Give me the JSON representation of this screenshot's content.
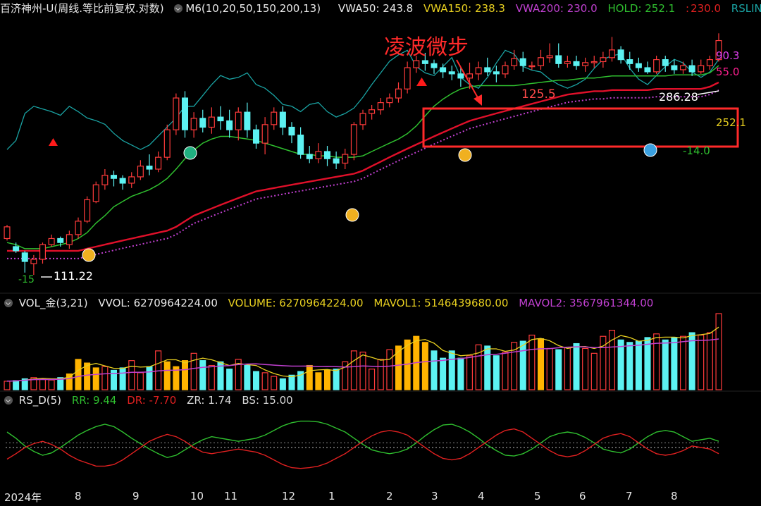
{
  "header_main": {
    "title": "百济神州-U(周线.等比前复权.对数)",
    "ma_label": "M6(10,20,50,150,200,13)",
    "vwa50": "VWA50: 243.8",
    "vwa150": "VWA150: 238.3",
    "vwa200": "VWA200: 230.0",
    "hold": "HOLD: 252.1",
    "sep": ":",
    "hold2": "230.0",
    "rslin": "RSLIN"
  },
  "header_vol": {
    "title": "VOL_金(3,21)",
    "vvol": "VVOL: 6270964224.00",
    "volume": "VOLUME: 6270964224.00",
    "mavol1": "MAVOL1: 5146439680.00",
    "mavol2": "MAVOL2: 3567961344.00"
  },
  "header_rs": {
    "title": "RS_D(5)",
    "rr": "RR: 9.44",
    "dr": "DR: -7.70",
    "zr": "ZR: 1.74",
    "bs": "BS: 15.00"
  },
  "annotations": {
    "box_title": "凌波微步",
    "peak_label": "125.5",
    "rs_high": "90.3",
    "rs_mid": "55.0",
    "price_high": "286.28",
    "price_hold": "252.1",
    "low_value": "111.22",
    "neg_14": "-14.0",
    "neg_15": "-15"
  },
  "x_labels": [
    "2024年",
    "8",
    "9",
    "10",
    "11",
    "12",
    "1",
    "2",
    "3",
    "4",
    "5",
    "6",
    "7",
    "8"
  ],
  "colors": {
    "up": "#ff3b3b",
    "down": "#5cf2f2",
    "vol_gold": "#ffb400",
    "ma_green": "#2fbf2f",
    "vwa_red": "#e0102a",
    "dotted": "#c040d0",
    "rslin": "#1aa3a3",
    "vol_ma1": "#e8d020",
    "vol_ma2": "#c040d0",
    "rs_green": "#2fbf2f",
    "rs_red": "#e02020",
    "box": "#ff2a2a"
  },
  "chart_data": [
    {
      "type": "candlestick",
      "title": "百济神州-U(周线.等比前复权.对数)",
      "scale": "log",
      "ylim": [
        108,
        300
      ],
      "candles": [
        [
          128,
          134,
          127,
          135
        ],
        [
          124,
          122,
          121,
          126
        ],
        [
          121,
          117,
          112,
          122
        ],
        [
          116,
          118,
          111,
          120
        ],
        [
          118,
          125,
          116,
          126
        ],
        [
          125,
          128,
          124,
          130
        ],
        [
          128,
          126,
          124,
          129
        ],
        [
          125,
          130,
          123,
          132
        ],
        [
          130,
          137,
          128,
          139
        ],
        [
          137,
          149,
          136,
          151
        ],
        [
          148,
          158,
          147,
          160
        ],
        [
          158,
          164,
          155,
          168
        ],
        [
          164,
          162,
          157,
          167
        ],
        [
          162,
          159,
          155,
          164
        ],
        [
          159,
          163,
          156,
          166
        ],
        [
          163,
          170,
          161,
          174
        ],
        [
          170,
          168,
          164,
          178
        ],
        [
          168,
          176,
          166,
          180
        ],
        [
          176,
          196,
          174,
          200
        ],
        [
          196,
          222,
          192,
          226
        ],
        [
          222,
          196,
          190,
          228
        ],
        [
          196,
          205,
          190,
          210
        ],
        [
          205,
          198,
          194,
          212
        ],
        [
          198,
          206,
          193,
          214
        ],
        [
          206,
          203,
          196,
          215
        ],
        [
          203,
          196,
          190,
          212
        ],
        [
          196,
          210,
          188,
          214
        ],
        [
          210,
          196,
          190,
          218
        ],
        [
          196,
          186,
          182,
          200
        ],
        [
          186,
          200,
          178,
          206
        ],
        [
          200,
          210,
          196,
          214
        ],
        [
          210,
          198,
          192,
          215
        ],
        [
          198,
          192,
          186,
          202
        ],
        [
          192,
          178,
          175,
          198
        ],
        [
          178,
          175,
          172,
          184
        ],
        [
          175,
          180,
          172,
          186
        ],
        [
          180,
          175,
          170,
          184
        ],
        [
          175,
          172,
          168,
          180
        ],
        [
          172,
          178,
          168,
          182
        ],
        [
          178,
          200,
          174,
          202
        ],
        [
          200,
          209,
          196,
          212
        ],
        [
          209,
          212,
          204,
          216
        ],
        [
          212,
          218,
          208,
          222
        ],
        [
          218,
          222,
          214,
          226
        ],
        [
          222,
          230,
          218,
          236
        ],
        [
          230,
          250,
          226,
          256
        ],
        [
          250,
          257,
          245,
          262
        ],
        [
          257,
          254,
          247,
          265
        ],
        [
          254,
          250,
          244,
          258
        ],
        [
          250,
          246,
          240,
          254
        ],
        [
          246,
          244,
          238,
          252
        ],
        [
          244,
          240,
          232,
          250
        ],
        [
          240,
          244,
          230,
          255
        ],
        [
          244,
          250,
          238,
          256
        ],
        [
          250,
          246,
          242,
          260
        ],
        [
          246,
          244,
          236,
          252
        ],
        [
          244,
          252,
          240,
          256
        ],
        [
          252,
          259,
          248,
          268
        ],
        [
          259,
          252,
          246,
          266
        ],
        [
          252,
          252,
          248,
          256
        ],
        [
          252,
          260,
          248,
          268
        ],
        [
          260,
          262,
          255,
          275
        ],
        [
          262,
          254,
          250,
          275
        ],
        [
          254,
          256,
          250,
          262
        ],
        [
          256,
          252,
          248,
          262
        ],
        [
          252,
          255,
          246,
          260
        ],
        [
          255,
          256,
          250,
          262
        ],
        [
          256,
          260,
          250,
          266
        ],
        [
          260,
          268,
          256,
          282
        ],
        [
          268,
          258,
          254,
          272
        ],
        [
          258,
          254,
          248,
          266
        ],
        [
          254,
          250,
          246,
          260
        ],
        [
          250,
          246,
          244,
          256
        ],
        [
          246,
          258,
          244,
          262
        ],
        [
          258,
          252,
          246,
          262
        ],
        [
          252,
          248,
          244,
          258
        ],
        [
          248,
          252,
          244,
          256
        ],
        [
          252,
          246,
          242,
          258
        ],
        [
          246,
          252,
          244,
          258
        ],
        [
          252,
          258,
          248,
          262
        ],
        [
          258,
          278,
          256,
          286
        ]
      ],
      "series": [
        {
          "name": "RSLIN",
          "values": [
            190,
            200,
            230,
            238,
            235,
            232,
            228,
            238,
            232,
            225,
            222,
            218,
            208,
            200,
            195,
            190,
            195,
            205,
            215,
            225,
            238,
            238,
            250,
            262,
            272,
            268,
            270,
            275,
            262,
            258,
            250,
            240,
            238,
            232,
            240,
            242,
            232,
            226,
            230,
            236,
            248,
            262,
            275,
            288,
            295,
            300,
            282,
            275,
            272,
            282,
            292,
            270,
            262,
            258,
            270,
            286,
            300,
            296,
            282,
            278,
            276,
            268,
            262,
            258,
            262,
            268,
            280,
            290,
            294,
            296,
            280,
            268,
            262,
            272,
            282,
            290,
            286,
            276,
            270,
            276,
            290
          ]
        },
        {
          "name": "HOLD",
          "values": [
            126,
            125,
            123,
            123,
            123,
            124,
            125,
            126,
            128,
            131,
            136,
            140,
            145,
            148,
            151,
            153,
            155,
            158,
            162,
            168,
            175,
            181,
            186,
            189,
            191,
            191,
            190,
            189,
            188,
            186,
            184,
            182,
            180,
            178,
            178,
            177,
            177,
            176,
            176,
            176,
            177,
            180,
            183,
            186,
            189,
            193,
            199,
            207,
            215,
            221,
            226,
            230,
            232,
            233,
            233,
            233,
            233,
            233,
            234,
            235,
            236,
            237,
            238,
            238,
            239,
            240,
            240,
            241,
            242,
            242,
            242,
            242,
            242,
            242,
            242,
            243,
            243,
            243,
            243,
            245,
            252
          ]
        },
        {
          "name": "VWA200",
          "values": [
            122,
            122,
            122,
            122,
            122,
            122,
            122,
            122,
            122,
            123,
            124,
            125,
            126,
            127,
            128,
            129,
            130,
            131,
            132,
            134,
            137,
            140,
            142,
            144,
            146,
            148,
            150,
            152,
            154,
            155,
            156,
            157,
            158,
            159,
            160,
            161,
            162,
            163,
            164,
            165,
            167,
            170,
            173,
            176,
            179,
            182,
            185,
            188,
            191,
            194,
            197,
            200,
            203,
            205,
            207,
            209,
            211,
            213,
            215,
            217,
            219,
            221,
            223,
            225,
            226,
            227,
            228,
            228,
            229,
            229,
            229,
            229,
            229,
            230,
            230,
            230,
            230,
            230,
            230,
            232,
            236
          ]
        }
      ],
      "markers": [
        {
          "label": "up-arrow",
          "x": 11
        },
        {
          "label": "down-arrow",
          "x": 24
        },
        {
          "label": "up-arrow",
          "x": 47
        },
        {
          "label": "up-arrow",
          "x": 7
        },
        {
          "label": "coin",
          "x": 59
        },
        {
          "label": "sell",
          "x": 24
        }
      ]
    },
    {
      "type": "bar",
      "title": "VOL_金(3,21)",
      "ylim": [
        0,
        7000000000
      ],
      "values": [
        700,
        750,
        900,
        1000,
        900,
        800,
        1000,
        1300,
        2500,
        2200,
        1800,
        1900,
        1600,
        1800,
        2400,
        1400,
        1900,
        3200,
        2300,
        1900,
        2400,
        3000,
        2400,
        2000,
        2300,
        1700,
        2500,
        2000,
        1500,
        1400,
        1100,
        900,
        1200,
        1500,
        2000,
        1400,
        1600,
        1700,
        2300,
        3200,
        3100,
        1700,
        2500,
        3300,
        3600,
        4100,
        4400,
        3900,
        3200,
        2600,
        3200,
        2600,
        2800,
        3700,
        3600,
        2800,
        3100,
        3900,
        4000,
        4500,
        4200,
        3400,
        3300,
        3500,
        3800,
        3400,
        3000,
        4400,
        4900,
        4100,
        3900,
        4000,
        4300,
        4600,
        4100,
        4300,
        4400,
        4700,
        4500,
        4700,
        6271
      ]
    },
    {
      "type": "line",
      "title": "RS_D(5)",
      "series": [
        {
          "name": "RR",
          "values": [
            70,
            62,
            52,
            45,
            40,
            43,
            50,
            58,
            66,
            72,
            77,
            80,
            77,
            70,
            62,
            55,
            48,
            42,
            37,
            40,
            47,
            54,
            60,
            64,
            62,
            60,
            58,
            60,
            62,
            66,
            72,
            78,
            82,
            84,
            84,
            83,
            80,
            75,
            70,
            62,
            54,
            47,
            44,
            42,
            44,
            48,
            56,
            65,
            73,
            79,
            80,
            76,
            70,
            62,
            53,
            46,
            40,
            39,
            42,
            48,
            56,
            64,
            68,
            70,
            68,
            63,
            56,
            48,
            45,
            43,
            48,
            56,
            64,
            70,
            72,
            70,
            64,
            58,
            60,
            62,
            58
          ]
        },
        {
          "name": "DR",
          "values": [
            35,
            42,
            50,
            55,
            58,
            54,
            48,
            40,
            34,
            30,
            26,
            26,
            28,
            34,
            42,
            50,
            58,
            63,
            67,
            64,
            58,
            50,
            44,
            42,
            44,
            46,
            48,
            46,
            44,
            40,
            34,
            28,
            24,
            23,
            24,
            26,
            30,
            36,
            42,
            50,
            58,
            65,
            70,
            72,
            70,
            66,
            58,
            50,
            42,
            36,
            34,
            36,
            42,
            50,
            58,
            66,
            72,
            74,
            70,
            62,
            54,
            46,
            40,
            38,
            40,
            46,
            54,
            62,
            66,
            68,
            64,
            56,
            48,
            42,
            40,
            42,
            46,
            52,
            50,
            48,
            42
          ]
        }
      ]
    }
  ]
}
